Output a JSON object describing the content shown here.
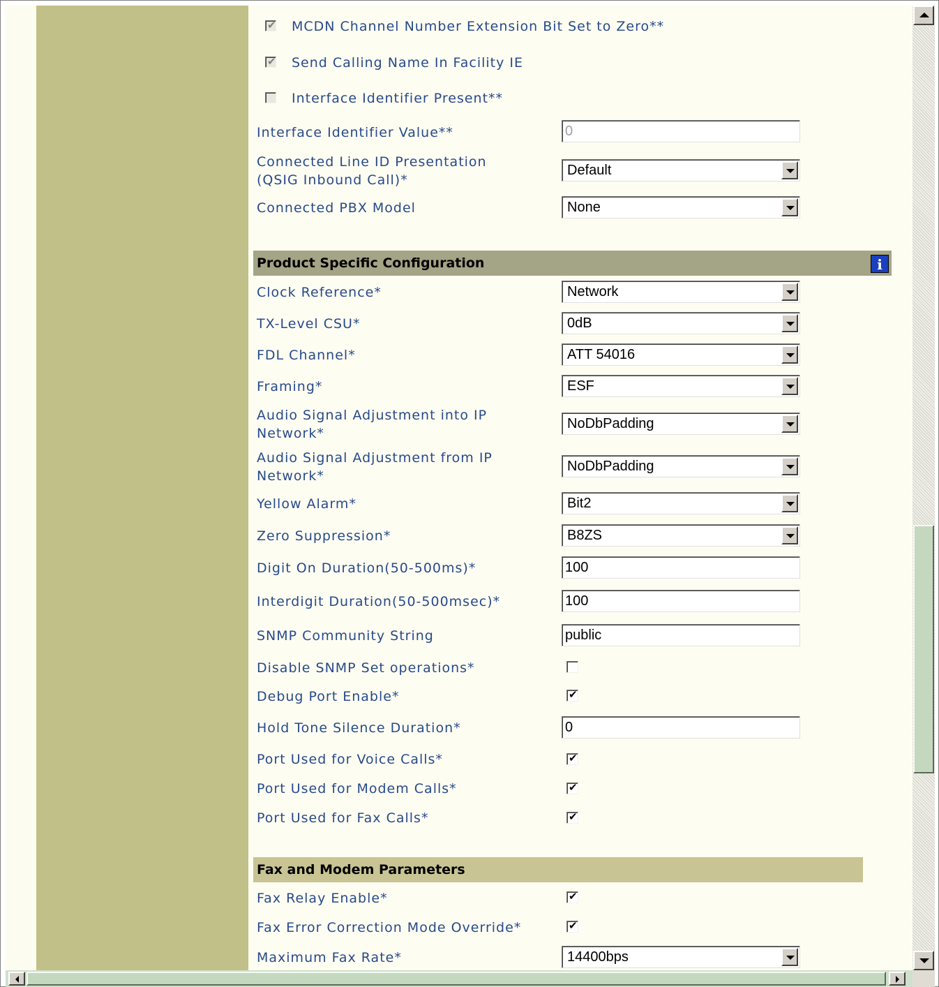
{
  "top_checkboxes": [
    {
      "label": "MCDN Channel Number Extension Bit Set to Zero**",
      "checked": true
    },
    {
      "label": "Send Calling Name In Facility IE",
      "checked": true
    },
    {
      "label": "Interface Identifier Present**",
      "checked": false
    }
  ],
  "top_fields": {
    "interface_identifier_value": {
      "label": "Interface Identifier Value**",
      "value": "0"
    },
    "connected_line_id": {
      "label_line1": "Connected Line ID Presentation",
      "label_line2": "(QSIG Inbound Call)*",
      "value": "Default"
    },
    "connected_pbx_model": {
      "label": "Connected PBX Model",
      "value": "None"
    }
  },
  "product_section": {
    "title": "Product Specific Configuration",
    "info_icon": "i",
    "fields": {
      "clock_reference": {
        "label": "Clock Reference*",
        "value": "Network"
      },
      "tx_level_csu": {
        "label": "TX-Level CSU*",
        "value": "0dB"
      },
      "fdl_channel": {
        "label": "FDL Channel*",
        "value": "ATT 54016"
      },
      "framing": {
        "label": "Framing*",
        "value": "ESF"
      },
      "audio_into_ip": {
        "label_line1": "Audio Signal Adjustment into IP",
        "label_line2": "Network*",
        "value": "NoDbPadding"
      },
      "audio_from_ip": {
        "label_line1": "Audio Signal Adjustment from IP",
        "label_line2": "Network*",
        "value": "NoDbPadding"
      },
      "yellow_alarm": {
        "label": "Yellow Alarm*",
        "value": "Bit2"
      },
      "zero_suppression": {
        "label": "Zero Suppression*",
        "value": "B8ZS"
      },
      "digit_on_duration": {
        "label": "Digit On Duration(50-500ms)*",
        "value": "100"
      },
      "interdigit_duration": {
        "label": "Interdigit Duration(50-500msec)*",
        "value": "100"
      },
      "snmp_community": {
        "label": "SNMP Community String",
        "value": "public"
      },
      "disable_snmp_set": {
        "label": "Disable SNMP Set operations*",
        "checked": false
      },
      "debug_port_enable": {
        "label": "Debug Port Enable*",
        "checked": true
      },
      "hold_tone_silence": {
        "label": "Hold Tone Silence Duration*",
        "value": "0"
      },
      "port_voice": {
        "label": "Port Used for Voice Calls*",
        "checked": true
      },
      "port_modem": {
        "label": "Port Used for Modem Calls*",
        "checked": true
      },
      "port_fax": {
        "label": "Port Used for Fax Calls*",
        "checked": true
      }
    }
  },
  "fax_section": {
    "title": "Fax and Modem Parameters",
    "fields": {
      "fax_relay_enable": {
        "label": "Fax Relay Enable*",
        "checked": true
      },
      "fax_ecm_override": {
        "label": "Fax Error Correction Mode Override*",
        "checked": true
      },
      "max_fax_rate": {
        "label": "Maximum Fax Rate*",
        "value": "14400bps"
      }
    }
  },
  "colors": {
    "sidebar": "#c0c088",
    "content_bg": "#fefdf2",
    "label_text": "#274a8a",
    "product_header": "#a4a486",
    "fax_header": "#c8c494",
    "info_icon_bg": "#1a3fbf"
  },
  "icons": [
    "checkmark-icon",
    "dropdown-arrow-icon",
    "info-icon",
    "scroll-up-icon",
    "scroll-down-icon",
    "scroll-left-icon",
    "scroll-right-icon"
  ]
}
